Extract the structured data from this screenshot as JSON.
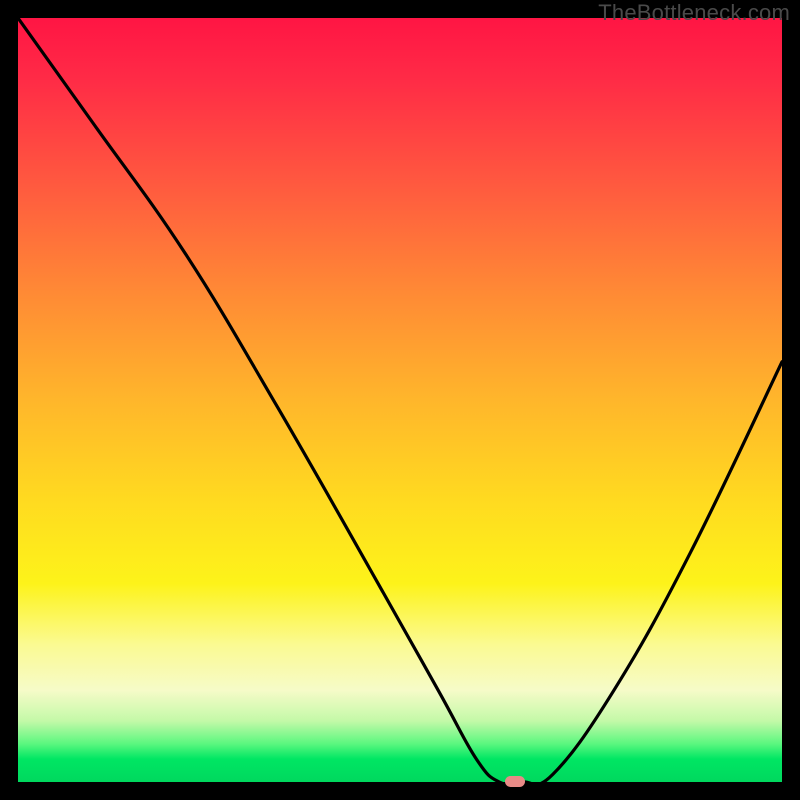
{
  "watermark": "TheBottleneck.com",
  "chart_data": {
    "type": "line",
    "title": "",
    "xlabel": "",
    "ylabel": "",
    "xlim": [
      0,
      100
    ],
    "ylim": [
      0,
      100
    ],
    "grid": false,
    "legend": false,
    "series": [
      {
        "name": "bottleneck-curve",
        "x": [
          0,
          10,
          22,
          34,
          46,
          55,
          60,
          63,
          66,
          70,
          78,
          88,
          100
        ],
        "y": [
          100,
          86,
          69,
          49,
          28,
          12,
          3,
          0,
          0,
          1,
          12,
          30,
          55
        ]
      }
    ],
    "marker": {
      "x": 65,
      "y": 0,
      "color": "#e88b87"
    },
    "background_gradient": {
      "stops": [
        {
          "pos": 0,
          "color": "#ff1544"
        },
        {
          "pos": 22,
          "color": "#ff5a3f"
        },
        {
          "pos": 50,
          "color": "#ffb62b"
        },
        {
          "pos": 74,
          "color": "#fdf31a"
        },
        {
          "pos": 88,
          "color": "#f6fbc8"
        },
        {
          "pos": 97,
          "color": "#00e663"
        },
        {
          "pos": 100,
          "color": "#00d85e"
        }
      ]
    }
  }
}
